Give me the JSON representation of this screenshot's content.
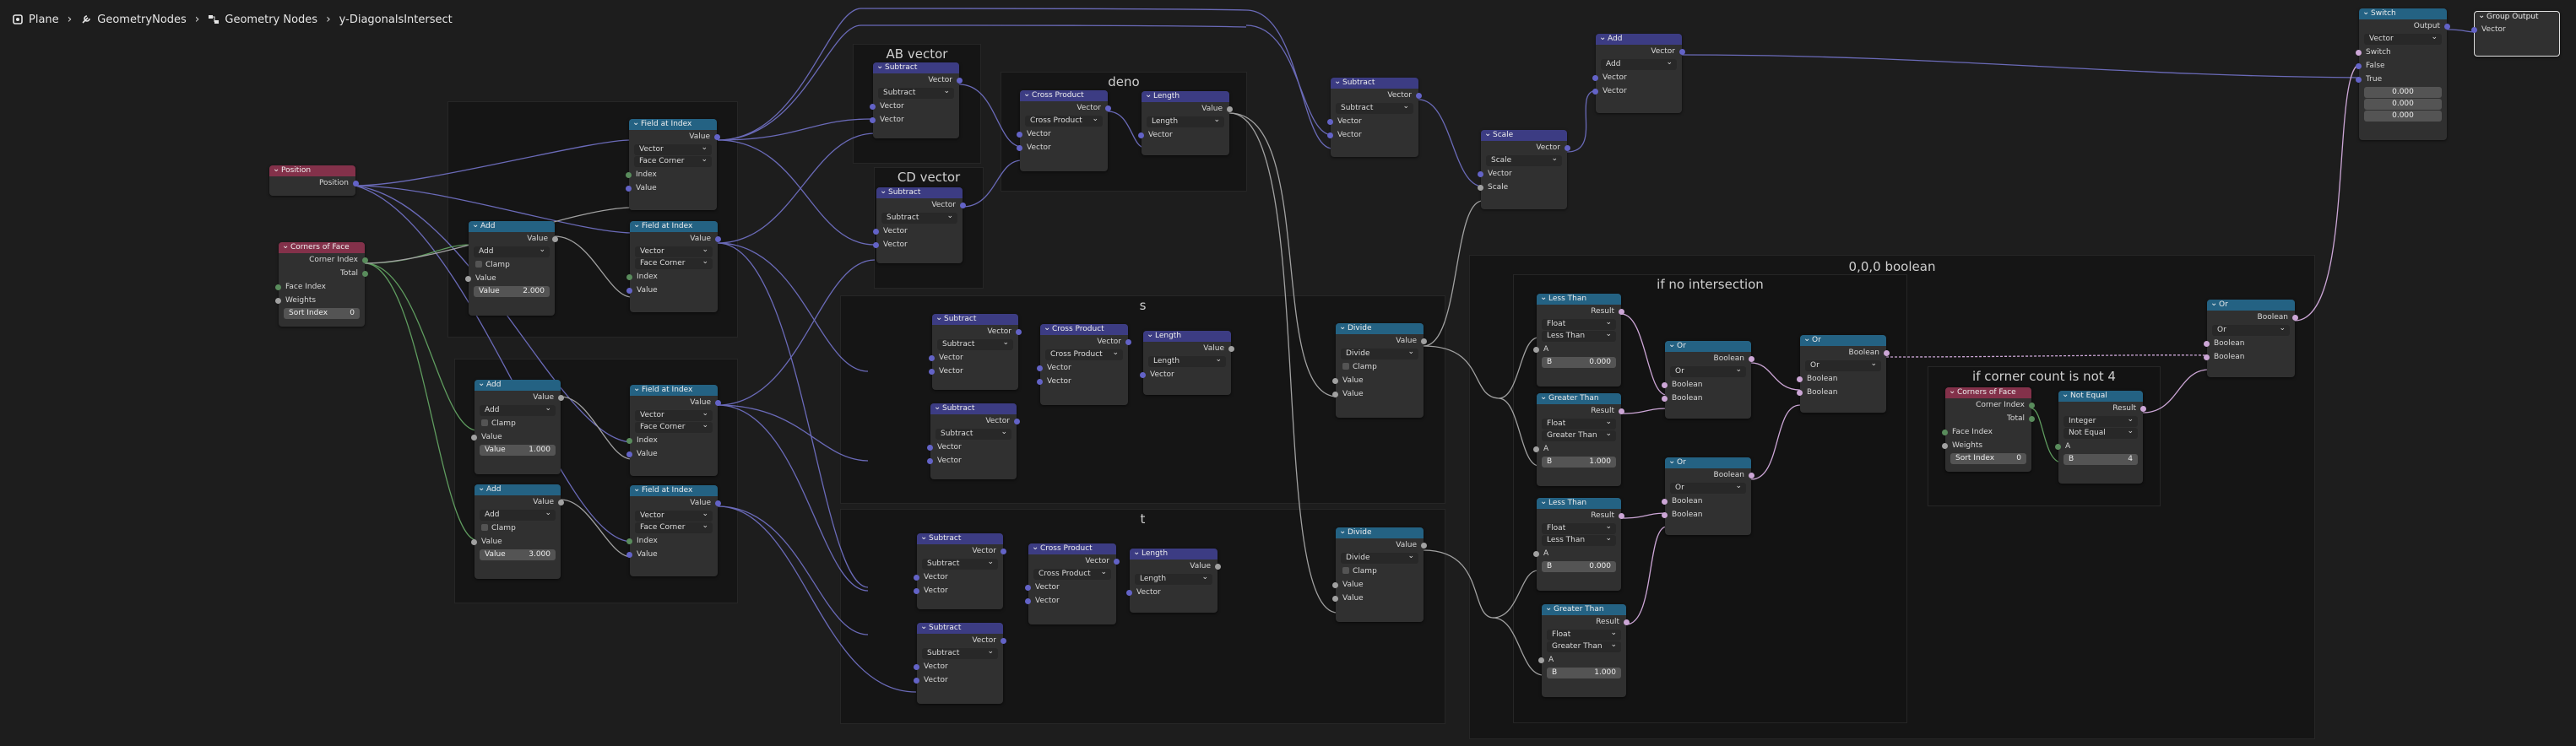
{
  "breadcrumb": {
    "items": [
      "Plane",
      "GeometryNodes",
      "Geometry Nodes",
      "y-DiagonalsIntersect"
    ]
  },
  "frames": {
    "ab_vector": "AB vector",
    "cd_vector": "CD vector",
    "deno": "deno",
    "s": "s",
    "t": "t",
    "boolean_000": "0,0,0 boolean",
    "if_no_intersection": "if  no intersection",
    "if_corner_count": "if corner count is not 4"
  },
  "nodes": {
    "position": {
      "title": "Position",
      "out": "Position"
    },
    "corners_of_face_1": {
      "title": "Corners of Face",
      "out1": "Corner Index",
      "out2": "Total",
      "in1": "Face Index",
      "in2": "Weights",
      "in3": "Sort Index",
      "sort_val": "0"
    },
    "corners_of_face_2": {
      "title": "Corners of Face",
      "out1": "Corner Index",
      "out2": "Total",
      "in1": "Face Index",
      "in2": "Weights",
      "in3": "Sort Index",
      "sort_val": "0"
    },
    "math_add": {
      "title": "Add",
      "out": "Value",
      "op": "Add",
      "clamp": "Clamp",
      "in1": "Value",
      "in2": "Value",
      "val": "2.000"
    },
    "math_add_1": {
      "title": "Add",
      "out": "Value",
      "op": "Add",
      "clamp": "Clamp",
      "in1": "Value",
      "in2": "Value",
      "val": "1.000"
    },
    "math_add_3": {
      "title": "Add",
      "out": "Value",
      "op": "Add",
      "clamp": "Clamp",
      "in1": "Value",
      "in2": "Value",
      "val": "3.000"
    },
    "field_at_index": {
      "title": "Field at Index",
      "out": "Value",
      "type": "Vector",
      "domain": "Face Corner",
      "in1": "Index",
      "in2": "Value"
    },
    "vec_subtract": {
      "title": "Subtract",
      "out": "Vector",
      "op": "Subtract",
      "in1": "Vector",
      "in2": "Vector"
    },
    "cross_product": {
      "title": "Cross Product",
      "out": "Vector",
      "op": "Cross Product",
      "in1": "Vector",
      "in2": "Vector"
    },
    "length": {
      "title": "Length",
      "out": "Value",
      "op": "Length",
      "in1": "Vector"
    },
    "divide": {
      "title": "Divide",
      "out": "Value",
      "op": "Divide",
      "clamp": "Clamp",
      "in1": "Value",
      "in2": "Value"
    },
    "scale": {
      "title": "Scale",
      "out": "Vector",
      "op": "Scale",
      "in1": "Vector",
      "in2": "Scale"
    },
    "vec_add": {
      "title": "Add",
      "out": "Vector",
      "op": "Add",
      "in1": "Vector",
      "in2": "Vector"
    },
    "switch": {
      "title": "Switch",
      "out": "Output",
      "type": "Vector",
      "in1": "Switch",
      "in2": "False",
      "in3": "True",
      "v1": "0.000",
      "v2": "0.000",
      "v3": "0.000"
    },
    "group_output": {
      "title": "Group Output",
      "in1": "Vector"
    },
    "less_than": {
      "title": "Less Than",
      "out": "Result",
      "type": "Float",
      "op": "Less Than",
      "in_a": "A",
      "in_b": "B",
      "b_val": "0.000"
    },
    "greater_than": {
      "title": "Greater Than",
      "out": "Result",
      "type": "Float",
      "op": "Greater Than",
      "in_a": "A",
      "in_b": "B",
      "b_val": "1.000"
    },
    "bool_or": {
      "title": "Or",
      "out": "Boolean",
      "op": "Or",
      "in1": "Boolean",
      "in2": "Boolean"
    },
    "not_equal": {
      "title": "Not Equal",
      "out": "Result",
      "type": "Integer",
      "op": "Not Equal",
      "in_a": "A",
      "in_b": "B",
      "b_val": "4"
    }
  }
}
